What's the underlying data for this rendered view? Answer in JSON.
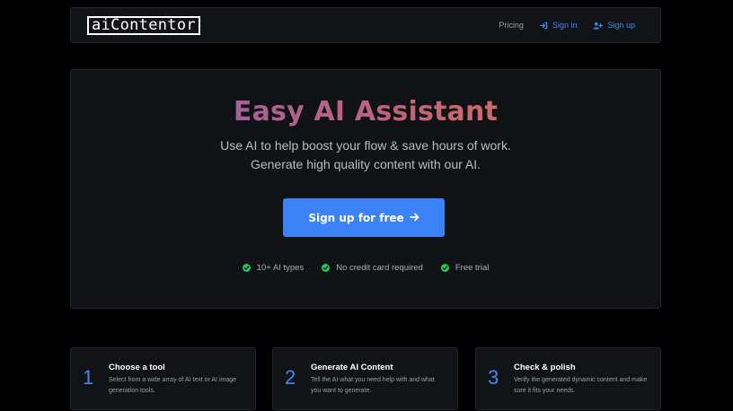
{
  "brand": {
    "logo_text": "aiContentor"
  },
  "nav": {
    "pricing": "Pricing",
    "sign_in": "Sign in",
    "sign_up": "Sign up",
    "sign_in_icon": "sign-in-icon",
    "sign_up_icon": "user-plus-icon"
  },
  "hero": {
    "title": "Easy AI Assistant",
    "subtitle": "Use AI to help boost your flow & save hours of work. Generate high quality content with our AI.",
    "cta_label": "Sign up for free",
    "cta_icon": "arrow-right-icon",
    "features": [
      "10+ AI types",
      "No credit card required",
      "Free trial"
    ]
  },
  "steps": [
    {
      "number": "1",
      "title": "Choose a tool",
      "description": "Select from a wide array of AI text or AI image generation tools."
    },
    {
      "number": "2",
      "title": "Generate AI Content",
      "description": "Tell the AI what you need help with and what you want to generate."
    },
    {
      "number": "3",
      "title": "Check & polish",
      "description": "Verify the generated dynamic content and make sure it fits your needs."
    }
  ],
  "colors": {
    "background": "#000000",
    "panel": "#111317",
    "accent_blue": "#3b82f6",
    "check_green": "#22c55e",
    "title_gradient": [
      "#8a5fb8",
      "#c0637a",
      "#e07a4e"
    ]
  }
}
